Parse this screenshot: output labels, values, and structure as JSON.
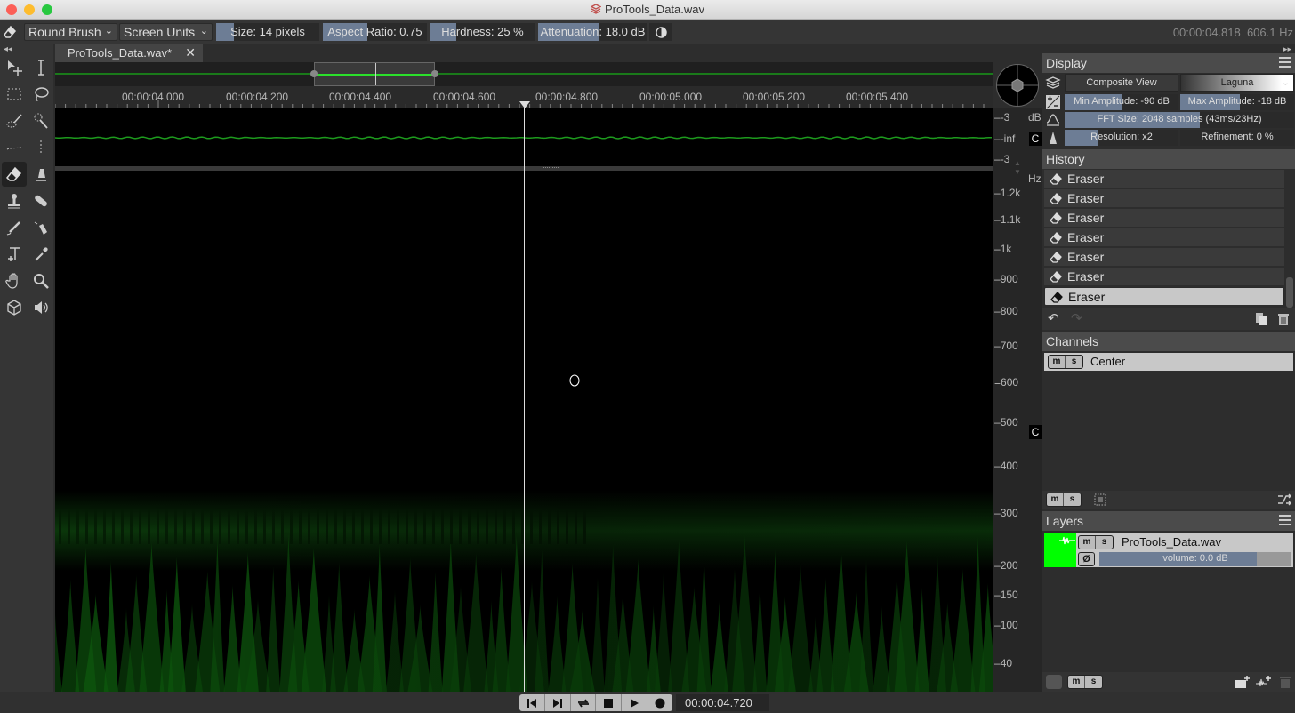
{
  "window": {
    "title": "ProTools_Data.wav",
    "traffic_lights": {
      "close": "#fc5f57",
      "minimize": "#fdbc2e",
      "zoom": "#28c840"
    }
  },
  "toolbar": {
    "tool_icon": "eraser-icon",
    "brush_type": "Round Brush",
    "units": "Screen Units",
    "size": {
      "label": "Size: 14 pixels",
      "fraction": 0.17
    },
    "aspect_ratio": {
      "label": "Aspect Ratio: 0.75",
      "fraction": 0.43
    },
    "hardness": {
      "label": "Hardness: 25 %",
      "fraction": 0.25
    },
    "attenuation": {
      "label": "Attenuation: 18.0 dB",
      "fraction": 0.55
    },
    "invert_icon": "contrast-icon",
    "readout": "00:00:04.818  606.1 Hz"
  },
  "tab": {
    "label": "ProTools_Data.wav*",
    "close": "✕"
  },
  "ruler": {
    "labels": [
      "00:00:04.000",
      "00:00:04.200",
      "00:00:04.400",
      "00:00:04.600",
      "00:00:04.800",
      "00:00:05.000",
      "00:00:05.200",
      "00:00:05.400"
    ]
  },
  "amp_scale": {
    "unit": "dB",
    "labels": [
      "-3",
      "-inf",
      "-3"
    ],
    "channel_badge": "C"
  },
  "freq_scale": {
    "unit": "Hz",
    "labels": [
      "1.2k",
      "1.1k",
      "1k",
      "900",
      "800",
      "700",
      "600",
      "500",
      "400",
      "300",
      "200",
      "150",
      "100",
      "40"
    ],
    "channel_badge": "C"
  },
  "transport": {
    "buttons": [
      "skip-back",
      "skip-forward",
      "loop",
      "stop",
      "play",
      "record"
    ],
    "time": "00:00:04.720"
  },
  "display_panel": {
    "title": "Display",
    "view_mode": "Composite View",
    "colormap": "Laguna",
    "min_amplitude": {
      "label": "Min Amplitude: -90 dB",
      "fraction": 0.5
    },
    "max_amplitude": {
      "label": "Max Amplitude: -18 dB",
      "fraction": 0.52
    },
    "fft_size": {
      "label": "FFT Size: 2048 samples (43ms/23Hz)",
      "fraction": 0.59
    },
    "resolution": {
      "label": "Resolution: x2",
      "fraction": 0.3
    },
    "refinement": {
      "label": "Refinement: 0 %",
      "fraction": 0.0
    }
  },
  "history_panel": {
    "title": "History",
    "items": [
      "Eraser",
      "Eraser",
      "Eraser",
      "Eraser",
      "Eraser",
      "Eraser",
      "Eraser"
    ],
    "selected_index": 6
  },
  "channels_panel": {
    "title": "Channels",
    "items": [
      {
        "name": "Center",
        "m": "m",
        "s": "s"
      }
    ]
  },
  "layers_panel": {
    "title": "Layers",
    "items": [
      {
        "name": "ProTools_Data.wav",
        "volume": "volume: 0.0 dB",
        "volume_fraction": 0.82,
        "color": "#00ff00"
      }
    ],
    "m": "m",
    "s": "s"
  }
}
